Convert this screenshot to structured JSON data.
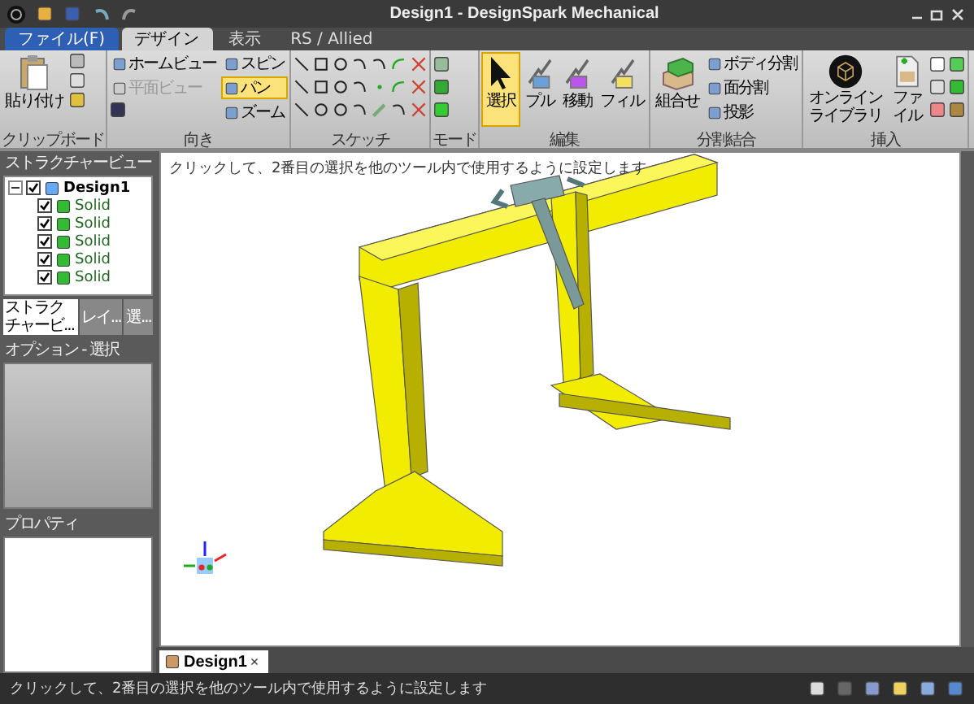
{
  "window": {
    "title": "Design1 - DesignSpark Mechanical"
  },
  "tabs": [
    {
      "label": "ファイル(F)",
      "kind": "file",
      "selected": false
    },
    {
      "label": "デザイン",
      "kind": "tab",
      "selected": true
    },
    {
      "label": "表示",
      "kind": "tab",
      "selected": false
    },
    {
      "label": "RS / Allied",
      "kind": "tab",
      "selected": false
    }
  ],
  "ribbon": [
    {
      "name": "クリップボード",
      "kind": "clipboard",
      "items": [
        {
          "label": "貼り付け",
          "kind": "large",
          "selected": false
        }
      ]
    },
    {
      "name": "向き",
      "kind": "orient",
      "items": [
        {
          "label": "ホームビュー",
          "kind": "small",
          "selected": false,
          "disabled": false
        },
        {
          "label": "平面ビュー",
          "kind": "small",
          "selected": false,
          "disabled": true
        },
        {
          "label": "スピン",
          "kind": "small",
          "selected": false,
          "disabled": false
        },
        {
          "label": "パン",
          "kind": "small",
          "selected": true,
          "disabled": false
        },
        {
          "label": "ズーム",
          "kind": "small",
          "selected": false,
          "disabled": false
        }
      ]
    },
    {
      "name": "スケッチ",
      "kind": "sketch"
    },
    {
      "name": "モード",
      "kind": "mode"
    },
    {
      "name": "編集",
      "kind": "edit",
      "items": [
        {
          "label": "選択",
          "kind": "large",
          "selected": true
        },
        {
          "label": "プル",
          "kind": "large",
          "selected": false
        },
        {
          "label": "移動",
          "kind": "large",
          "selected": false
        },
        {
          "label": "フィル",
          "kind": "large",
          "selected": false
        }
      ]
    },
    {
      "name": "分割結合",
      "kind": "split",
      "items": [
        {
          "label": "組合せ",
          "kind": "large",
          "selected": false
        },
        {
          "label": "ボディ分割",
          "kind": "small",
          "selected": false,
          "disabled": false
        },
        {
          "label": "面分割",
          "kind": "small",
          "selected": false,
          "disabled": false
        },
        {
          "label": "投影",
          "kind": "small",
          "selected": false,
          "disabled": false
        }
      ]
    },
    {
      "name": "挿入",
      "kind": "insert",
      "items": [
        {
          "label": "オンラインライブラリ",
          "kind": "large",
          "selected": false
        },
        {
          "label": "ファイル",
          "kind": "large",
          "selected": false
        }
      ]
    }
  ],
  "structure_panel": {
    "title": "ストラクチャービュー",
    "root": {
      "label": "Design1",
      "checked": true,
      "expanded": true,
      "children": [
        {
          "label": "Solid",
          "checked": true
        },
        {
          "label": "Solid",
          "checked": true
        },
        {
          "label": "Solid",
          "checked": true
        },
        {
          "label": "Solid",
          "checked": true
        },
        {
          "label": "Solid",
          "checked": true
        }
      ]
    },
    "tabs": [
      {
        "label": "ストラクチャービ...",
        "selected": true
      },
      {
        "label": "レイ...",
        "selected": false
      },
      {
        "label": "選...",
        "selected": false
      }
    ]
  },
  "options_panel": {
    "title": "オプション - 選択"
  },
  "properties_panel": {
    "title": "プロパティ"
  },
  "viewport": {
    "hint": "クリックして、2番目の選択を他のツール内で使用するように設定します"
  },
  "document_tabs": [
    {
      "label": "Design1",
      "close": "×",
      "selected": true
    }
  ],
  "status_bar": {
    "text": "クリックして、2番目の選択を他のツール内で使用するように設定します"
  }
}
